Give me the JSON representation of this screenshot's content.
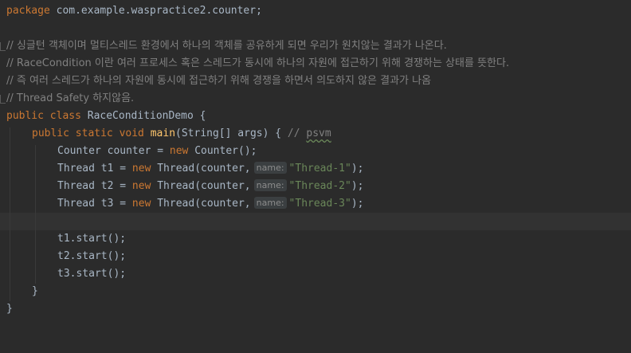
{
  "code": {
    "package_kw": "package",
    "package_name": "com.example.waspractice2.counter;",
    "comment1": "// 싱글턴 객체이며 멀티스레드 환경에서 하나의 객체를 공유하게 되면 우리가 원치않는 결과가 나온다.",
    "comment2": "// RaceCondition 이란 여러 프로세스 혹은 스레드가 동시에 하나의 자원에 접근하기 위해 경쟁하는 상태를 뜻한다.",
    "comment3": "// 즉 여러 스레드가 하나의 자원에 동시에 접근하기 위해 경쟁을 하면서 의도하지 않은 결과가 나옴",
    "comment4": "// Thread Safety 하지않음.",
    "class_kw": "public class",
    "class_name": "RaceConditionDemo {",
    "main_kw": "public static void",
    "main_name": "main",
    "main_params": "(String[] args) {",
    "main_comment": "// ",
    "main_comment_psvm": "psvm",
    "counter_decl": "Counter counter = ",
    "new_kw": "new",
    "counter_ctor": " Counter();",
    "t1_decl": "Thread t1 = ",
    "t2_decl": "Thread t2 = ",
    "t3_decl": "Thread t3 = ",
    "thread_ctor": " Thread(counter,",
    "hint_name": "name:",
    "t1_str": "\"Thread-1\"",
    "t2_str": "\"Thread-2\"",
    "t3_str": "\"Thread-3\"",
    "close_paren": ");",
    "t1_start": "t1.start();",
    "t2_start": "t2.start();",
    "t3_start": "t3.start();",
    "close_inner": "}",
    "close_outer": "}"
  },
  "colors": {
    "background": "#2b2b2b",
    "keyword": "#cc7832",
    "identifier": "#a9b7c6",
    "method": "#ffc66d",
    "string": "#6a8759",
    "comment": "#808080",
    "current_line": "#323232"
  }
}
